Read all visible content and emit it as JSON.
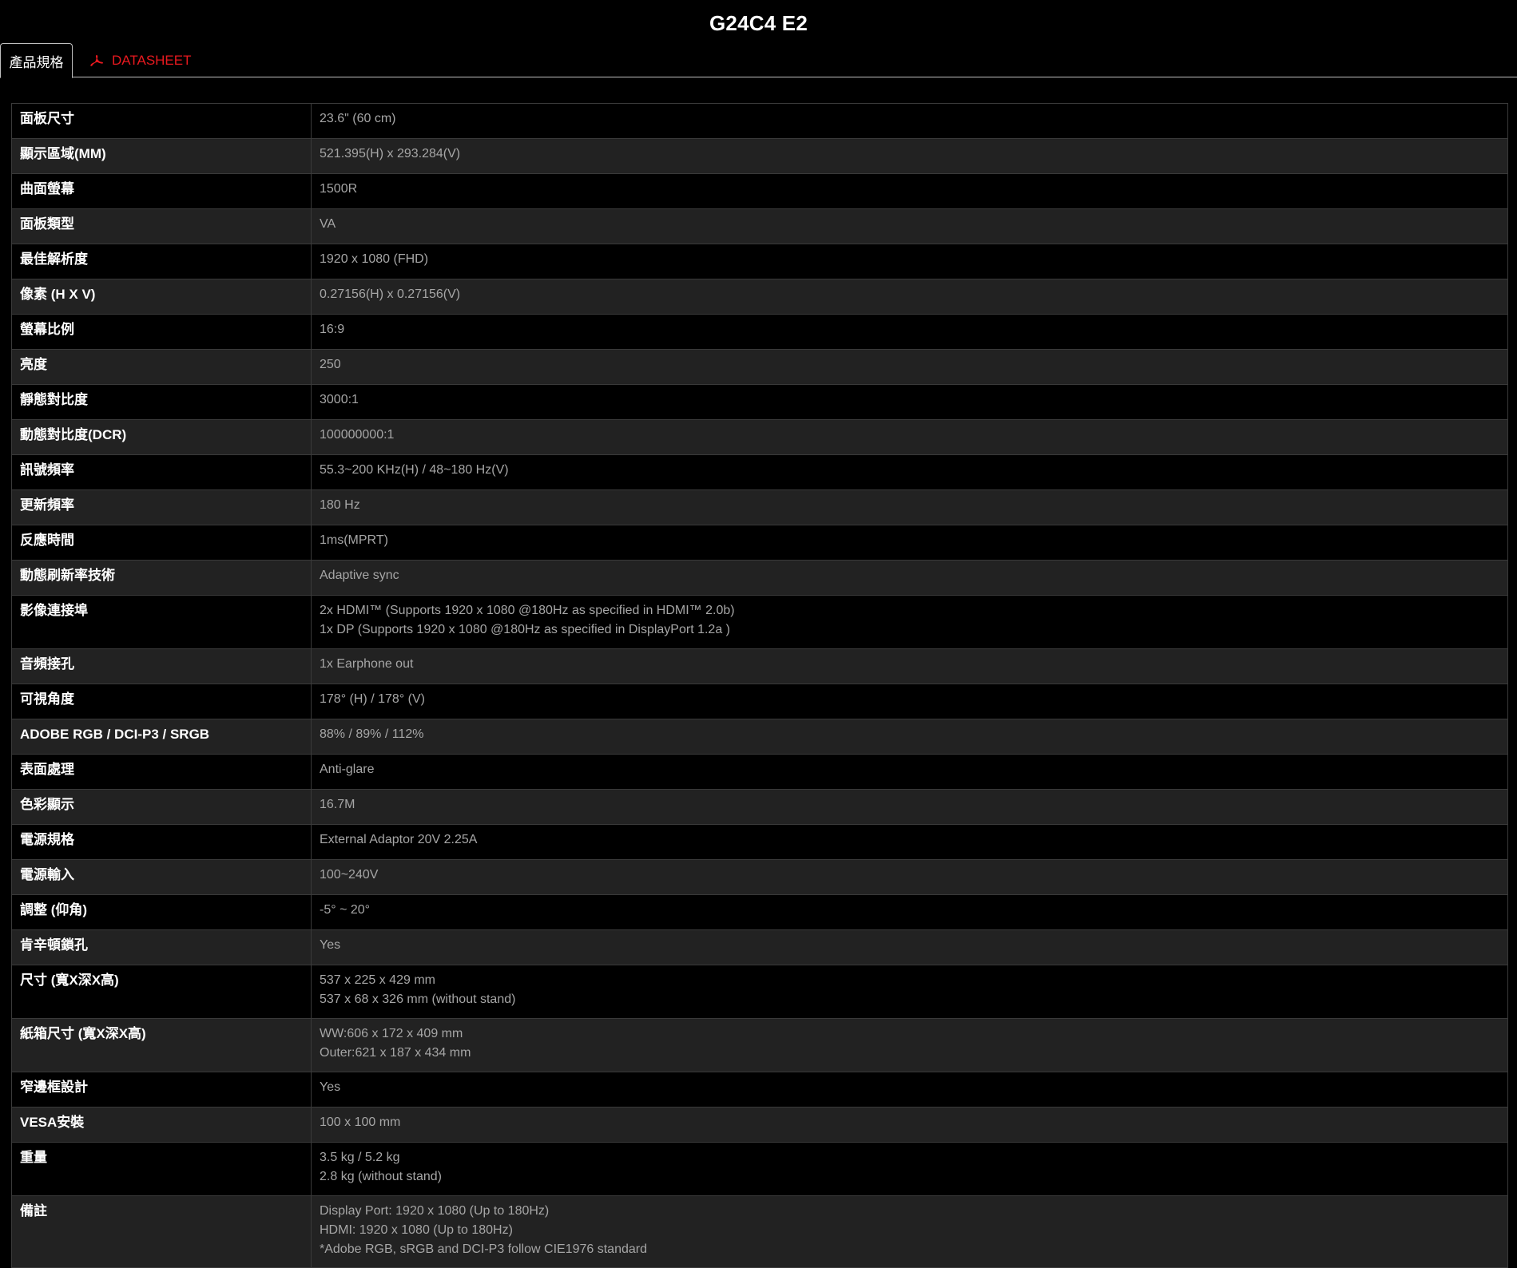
{
  "page": {
    "title": "G24C4 E2"
  },
  "tabs": {
    "specs_label": "產品規格",
    "datasheet_label": "DATASHEET",
    "datasheet_icon": "pdf-icon"
  },
  "colors": {
    "background": "#000000",
    "row_alt": "#222222",
    "accent_red": "#e8191f",
    "value_text": "#a6a6a6"
  },
  "specs": [
    {
      "label": "面板尺寸",
      "values": [
        "23.6\" (60 cm)"
      ]
    },
    {
      "label": "顯示區域(MM)",
      "values": [
        "521.395(H) x 293.284(V)"
      ]
    },
    {
      "label": "曲面螢幕",
      "values": [
        "1500R"
      ]
    },
    {
      "label": "面板類型",
      "values": [
        "VA"
      ]
    },
    {
      "label": "最佳解析度",
      "values": [
        "1920 x 1080 (FHD)"
      ]
    },
    {
      "label": "像素 (H X V)",
      "values": [
        "0.27156(H) x 0.27156(V)"
      ]
    },
    {
      "label": "螢幕比例",
      "values": [
        "16:9"
      ]
    },
    {
      "label": "亮度",
      "values": [
        "250"
      ]
    },
    {
      "label": "靜態對比度",
      "values": [
        "3000:1"
      ]
    },
    {
      "label": "動態對比度(DCR)",
      "values": [
        "100000000:1"
      ]
    },
    {
      "label": "訊號頻率",
      "values": [
        "55.3~200 KHz(H) / 48~180 Hz(V)"
      ]
    },
    {
      "label": "更新頻率",
      "values": [
        "180 Hz"
      ]
    },
    {
      "label": "反應時間",
      "values": [
        "1ms(MPRT)"
      ]
    },
    {
      "label": "動態刷新率技術",
      "values": [
        "Adaptive sync"
      ]
    },
    {
      "label": "影像連接埠",
      "values": [
        "2x HDMI™ (Supports 1920 x 1080 @180Hz as specified in HDMI™ 2.0b)",
        "1x DP (Supports 1920 x 1080 @180Hz as specified in DisplayPort 1.2a )"
      ]
    },
    {
      "label": "音頻接孔",
      "values": [
        "1x Earphone out"
      ]
    },
    {
      "label": "可視角度",
      "values": [
        "178° (H) / 178° (V)"
      ]
    },
    {
      "label": "ADOBE RGB / DCI-P3 / SRGB",
      "values": [
        "88% / 89% / 112%"
      ]
    },
    {
      "label": "表面處理",
      "values": [
        "Anti-glare"
      ]
    },
    {
      "label": "色彩顯示",
      "values": [
        "16.7M"
      ]
    },
    {
      "label": "電源規格",
      "values": [
        "External Adaptor 20V 2.25A"
      ]
    },
    {
      "label": "電源輸入",
      "values": [
        "100~240V"
      ]
    },
    {
      "label": "調整 (仰角)",
      "values": [
        "-5° ~ 20°"
      ]
    },
    {
      "label": "肯辛頓鎖孔",
      "values": [
        "Yes"
      ]
    },
    {
      "label": "尺寸 (寬X深X高)",
      "values": [
        "537 x 225 x 429 mm",
        "537 x 68 x 326 mm (without stand)"
      ]
    },
    {
      "label": "紙箱尺寸 (寬X深X高)",
      "values": [
        "WW:606 x 172 x 409 mm",
        "Outer:621 x 187 x 434 mm"
      ]
    },
    {
      "label": "窄邊框設計",
      "values": [
        "Yes"
      ]
    },
    {
      "label": "VESA安裝",
      "values": [
        "100 x 100 mm"
      ]
    },
    {
      "label": "重量",
      "values": [
        "3.5 kg / 5.2 kg",
        "2.8 kg (without stand)"
      ]
    },
    {
      "label": "備註",
      "values": [
        "Display Port: 1920 x 1080 (Up to 180Hz)",
        "HDMI: 1920 x 1080 (Up to 180Hz)",
        "*Adobe RGB, sRGB and DCI-P3 follow CIE1976 standard"
      ]
    }
  ]
}
